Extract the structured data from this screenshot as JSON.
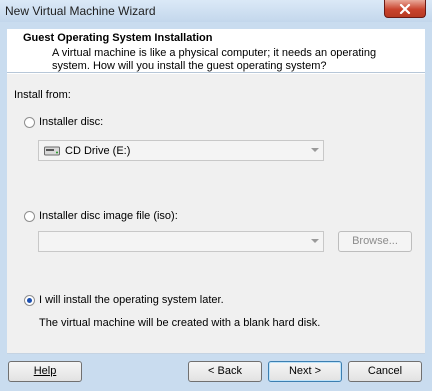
{
  "window": {
    "title": "New Virtual Machine Wizard"
  },
  "header": {
    "title": "Guest Operating System Installation",
    "description": "A virtual machine is like a physical computer; it needs an operating system. How will you install the guest operating system?"
  },
  "install_from": {
    "label": "Install from:",
    "installer_disc": {
      "label": "Installer disc:",
      "selected": false,
      "drive_value": "CD Drive (E:)"
    },
    "iso": {
      "label": "Installer disc image file (iso):",
      "selected": false,
      "value": "",
      "browse_label": "Browse..."
    },
    "later": {
      "label": "I will install the operating system later.",
      "selected": true,
      "note": "The virtual machine will be created with a blank hard disk."
    }
  },
  "buttons": {
    "help": "Help",
    "back": "< Back",
    "next": "Next >",
    "cancel": "Cancel"
  },
  "icons": {
    "close": "close-icon",
    "cd_drive": "cd-drive-icon"
  }
}
